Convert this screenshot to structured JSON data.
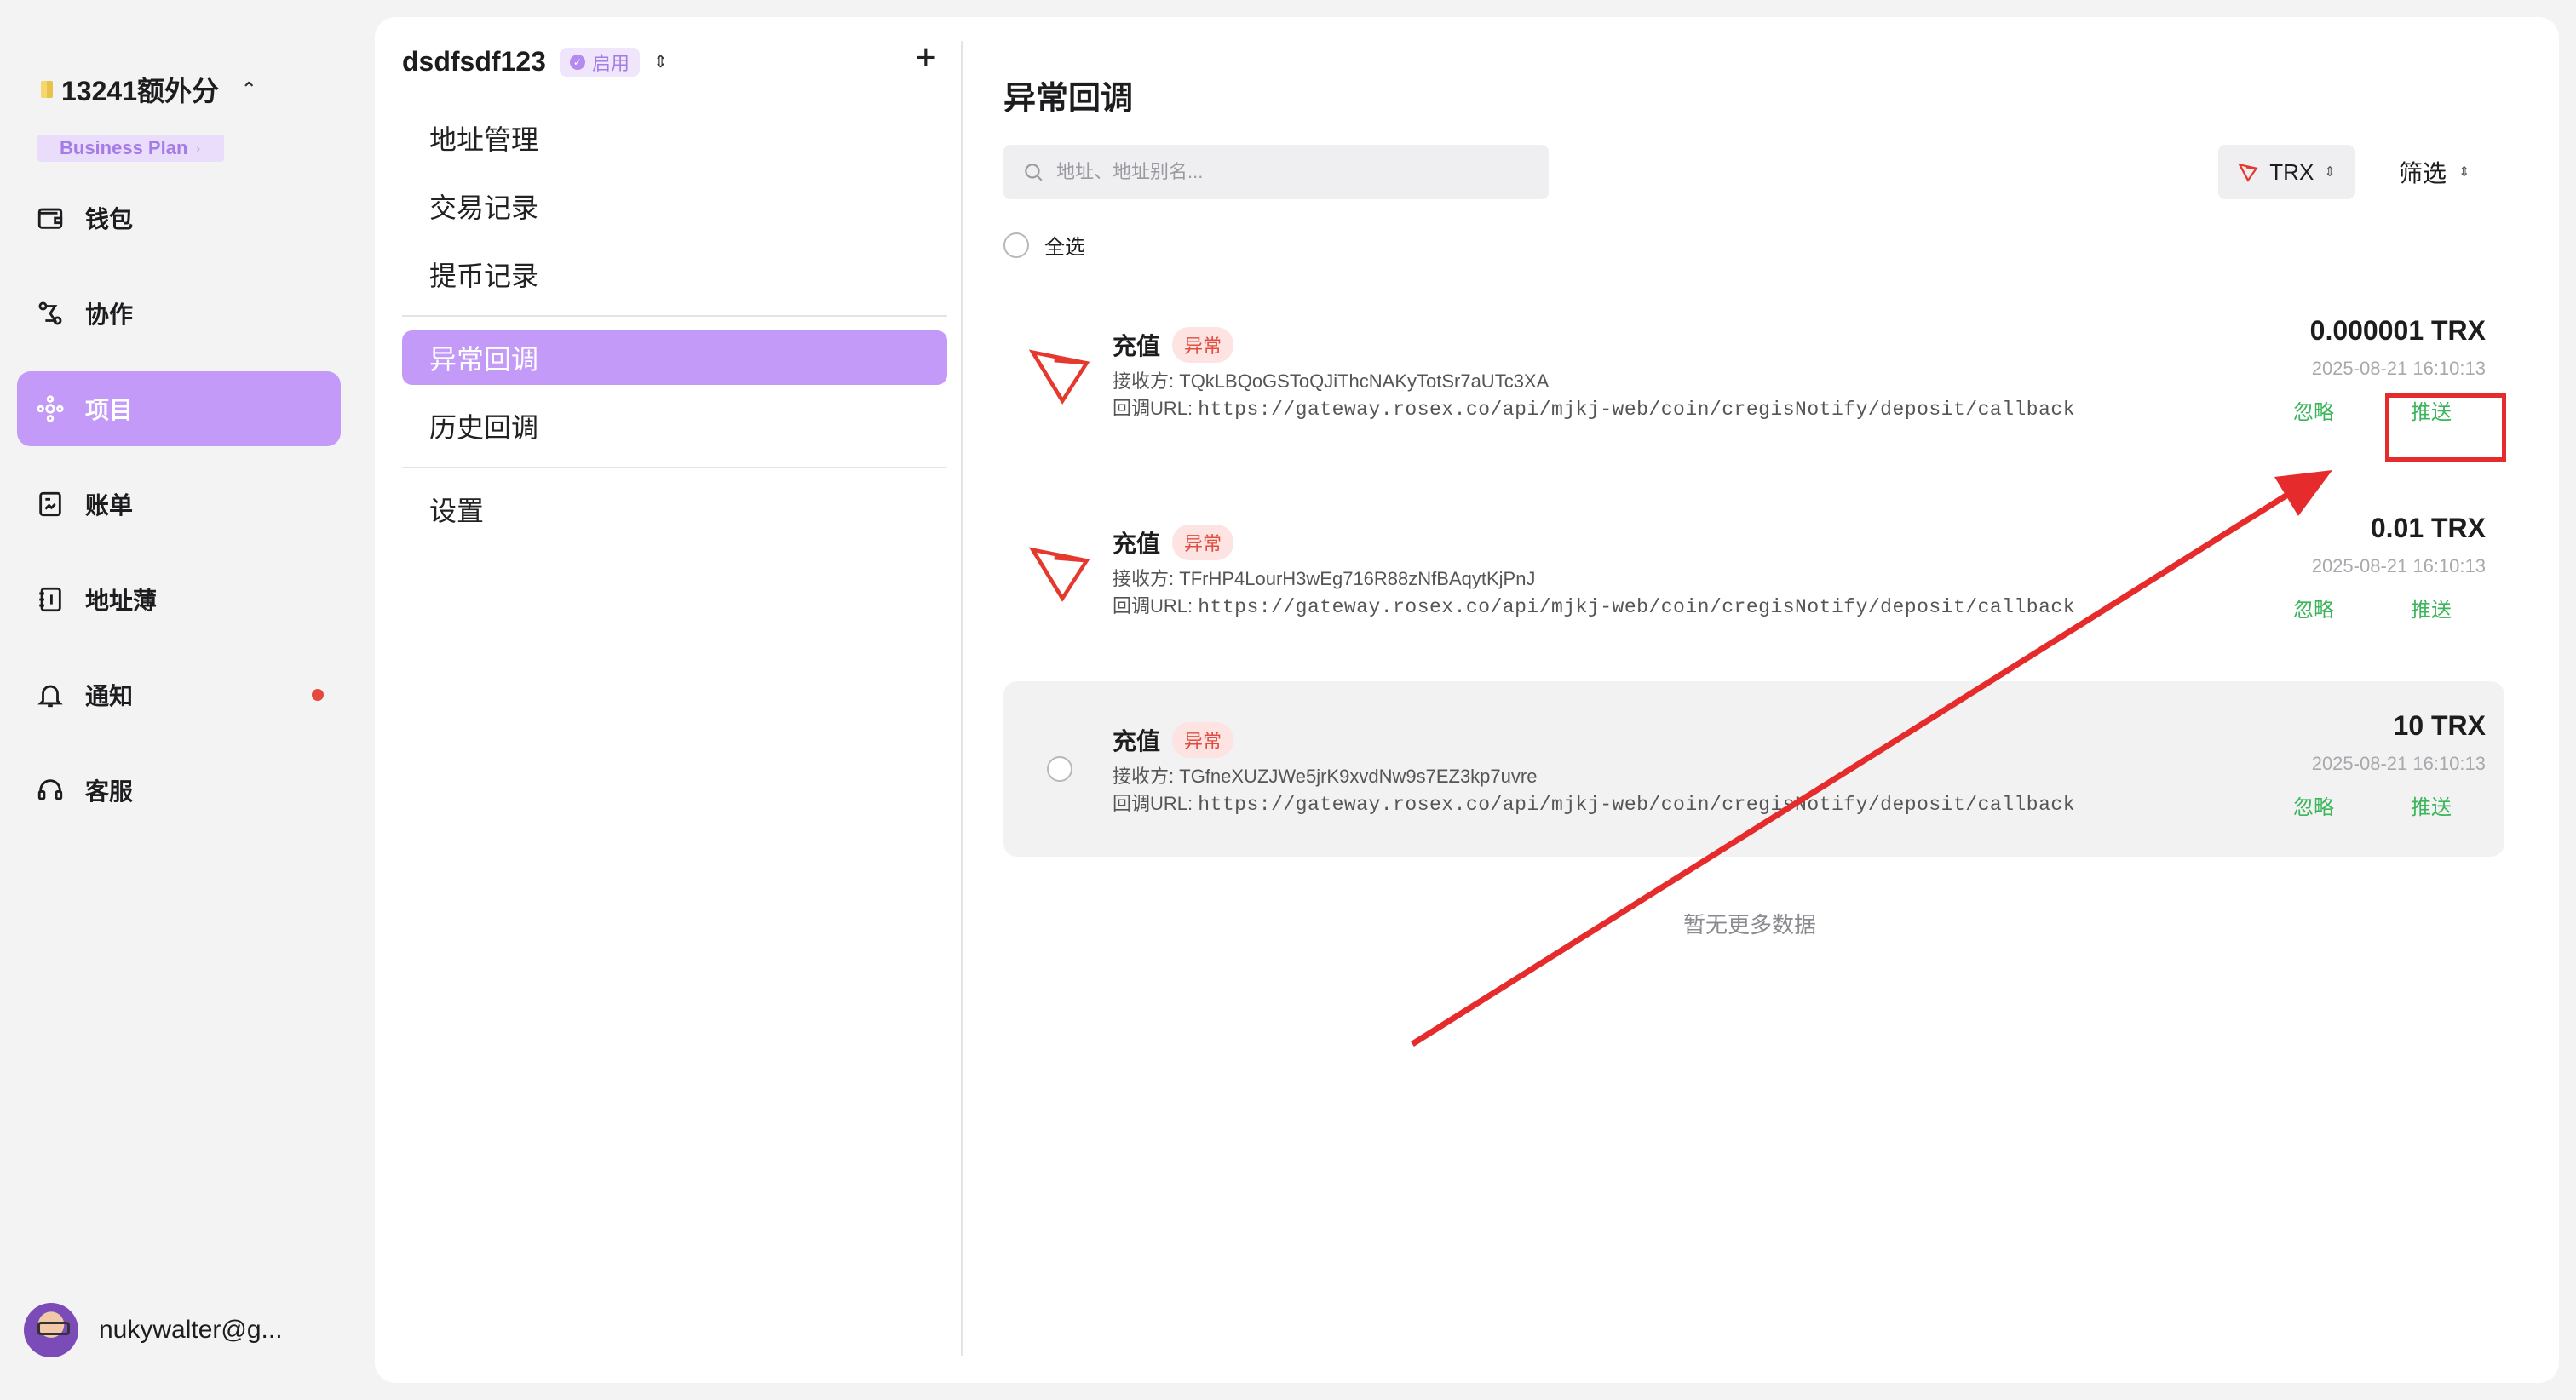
{
  "sidebar": {
    "org_name": "13241额外分",
    "plan_label": "Business Plan",
    "items": [
      {
        "label": "钱包",
        "icon": "wallet-icon"
      },
      {
        "label": "协作",
        "icon": "collab-icon"
      },
      {
        "label": "项目",
        "icon": "project-icon",
        "active": true
      },
      {
        "label": "账单",
        "icon": "bill-icon"
      },
      {
        "label": "地址薄",
        "icon": "address-book-icon"
      },
      {
        "label": "通知",
        "icon": "bell-icon",
        "has_dot": true
      },
      {
        "label": "客服",
        "icon": "headset-icon"
      }
    ],
    "user_email": "nukywalter@g..."
  },
  "project": {
    "name": "dsdfsdf123",
    "status": "启用",
    "menu": [
      "地址管理",
      "交易记录",
      "提币记录",
      "异常回调",
      "历史回调",
      "设置"
    ],
    "active_menu": "异常回调"
  },
  "main": {
    "title": "异常回调",
    "search_placeholder": "地址、地址别名...",
    "coin": "TRX",
    "filter_label": "筛选",
    "select_all": "全选",
    "rows": [
      {
        "type": "充值",
        "status": "异常",
        "receiver_label": "接收方:",
        "receiver": "TQkLBQoGSToQJiThcNAKyTotSr7aUTc3XA",
        "url_label": "回调URL:",
        "url": "https://gateway.rosex.co/api/mjkj-web/coin/cregisNotify/deposit/callback",
        "amount": "0.000001 TRX",
        "time": "2025-08-21 16:10:13",
        "ignore": "忽略",
        "push": "推送"
      },
      {
        "type": "充值",
        "status": "异常",
        "receiver_label": "接收方:",
        "receiver": "TFrHP4LourH3wEg716R88zNfBAqytKjPnJ",
        "url_label": "回调URL:",
        "url": "https://gateway.rosex.co/api/mjkj-web/coin/cregisNotify/deposit/callback",
        "amount": "0.01 TRX",
        "time": "2025-08-21 16:10:13",
        "ignore": "忽略",
        "push": "推送"
      },
      {
        "type": "充值",
        "status": "异常",
        "receiver_label": "接收方:",
        "receiver": "TGfneXUZJWe5jrK9xvdNw9s7EZ3kp7uvre",
        "url_label": "回调URL:",
        "url": "https://gateway.rosex.co/api/mjkj-web/coin/cregisNotify/deposit/callback",
        "amount": "10 TRX",
        "time": "2025-08-21 16:10:13",
        "ignore": "忽略",
        "push": "推送"
      }
    ],
    "no_more": "暂无更多数据"
  },
  "colors": {
    "accent": "#c39af7",
    "success": "#3bb55a",
    "danger": "#e04c3f",
    "annotation": "#e52b2b"
  }
}
